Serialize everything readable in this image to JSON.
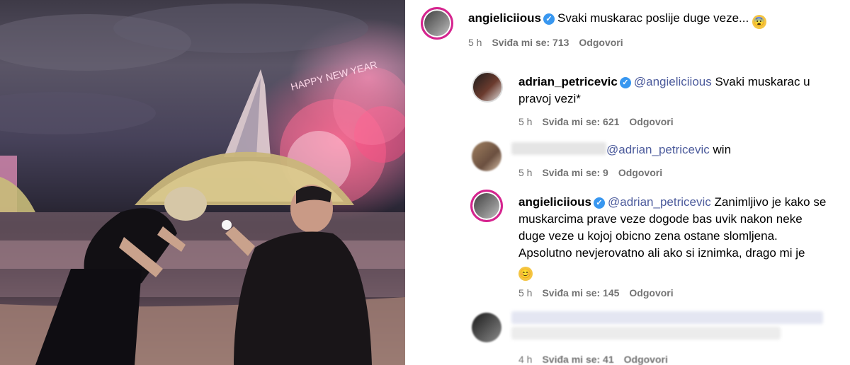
{
  "post": {
    "caption_user": "angieliciious",
    "caption_text": "Svaki muskarac poslije duge veze...",
    "caption_emoji": "😨",
    "caption_time": "5 h",
    "caption_likes": "Sviđa mi se: 713",
    "caption_reply": "Odgovori"
  },
  "comments": [
    {
      "user": "adrian_petricevic",
      "mention": "@angieliciious",
      "text": "Svaki muskarac u pravoj vezi*",
      "time": "5 h",
      "likes": "Sviđa mi se: 621",
      "reply": "Odgovori"
    },
    {
      "user": "",
      "mention": "@adrian_petricevic",
      "text": "win",
      "time": "5 h",
      "likes": "Sviđa mi se: 9",
      "reply": "Odgovori"
    },
    {
      "user": "angieliciious",
      "mention": "@adrian_petricevic",
      "text": "Zanimljivo je kako se muskarcima prave veze dogode bas uvik nakon neke duge veze u kojoj obicno zena ostane slomljena. Apsolutno nevjerovatno ali ako si iznimka, drago mi je",
      "emoji": "😊",
      "time": "5 h",
      "likes": "Sviđa mi se: 145",
      "reply": "Odgovori"
    },
    {
      "user": "",
      "text": "",
      "time": "4 h",
      "likes": "Sviđa mi se: 41",
      "reply": "Odgovori"
    }
  ],
  "photo": {
    "fireworks_text": "HAPPY NEW YEAR"
  },
  "colors": {
    "verified": "#3897f0",
    "mention": "#4c5b9c",
    "meta": "#737373",
    "story_ring": "#d6248f"
  }
}
